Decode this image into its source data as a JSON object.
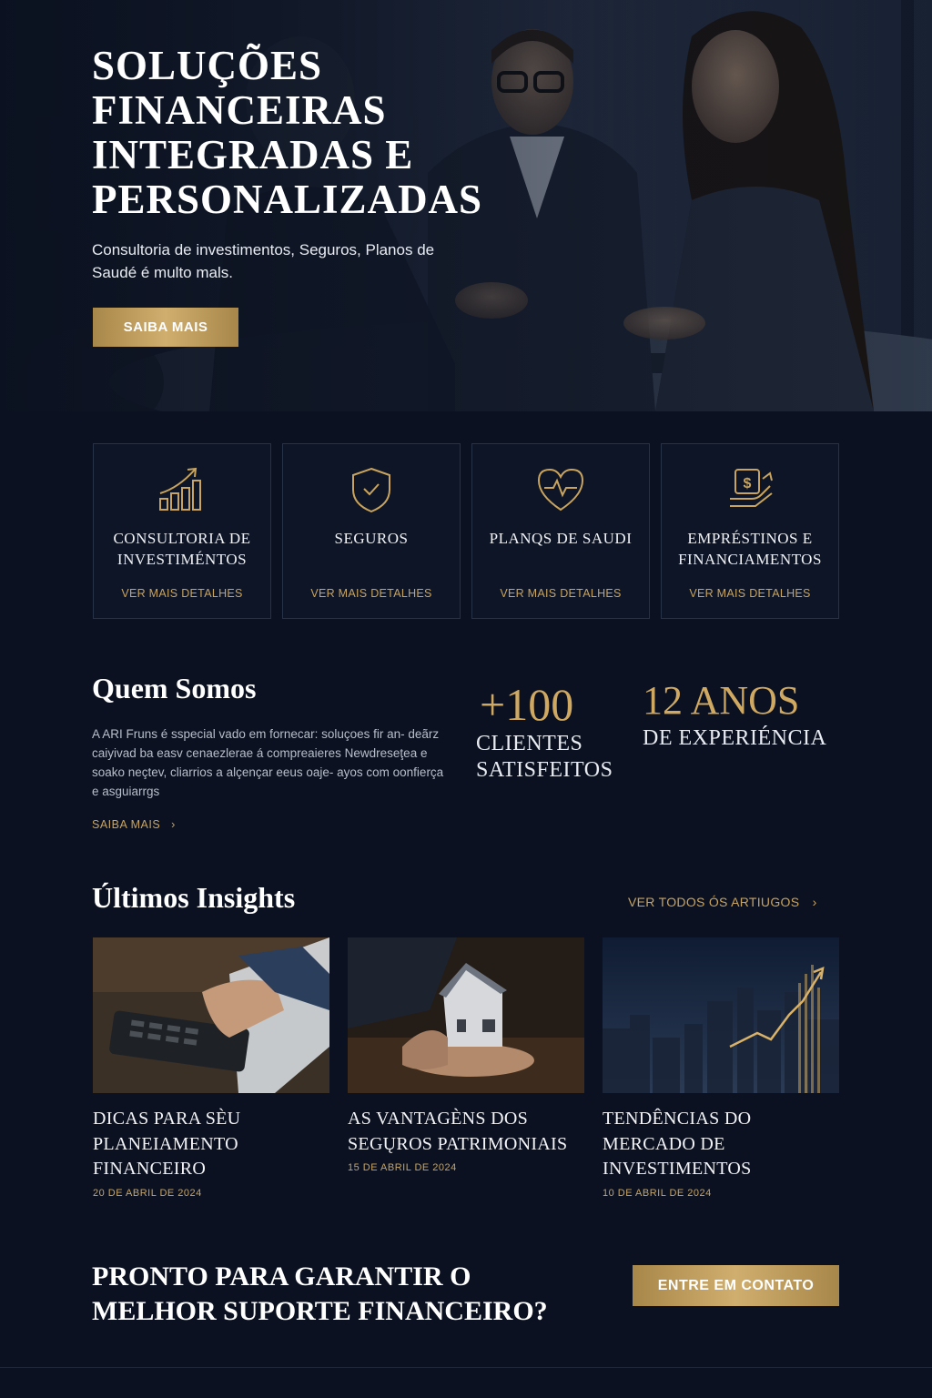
{
  "hero": {
    "title": "SOLUÇÕES FINANCEIRAS INTEGRADAS E PERSONALIZADAS",
    "subtitle": "Consultoria de investimentos, Seguros, Planos de Saudé é multo mals.",
    "button": "SAIBA MAIS"
  },
  "services": [
    {
      "title": "CONSULTORIA DE INVESTIMÉNTOS",
      "link": "VER MAIS DETALHES",
      "icon": "growth-chart-icon"
    },
    {
      "title": "SEGUROS",
      "link": "VER MAIS DETALHES",
      "icon": "shield-check-icon"
    },
    {
      "title": "PLANQS DE SAUDI",
      "link": "VER MAIS DETALHES",
      "icon": "heart-pulse-icon"
    },
    {
      "title": "EMPRÉSTINOS E FINANCIAMENTOS",
      "link": "VER MAIS DETALHES",
      "icon": "money-exchange-icon"
    }
  ],
  "about": {
    "title": "Quem Somos",
    "text": "A ARI Fruns é sspecial vado em fornecar: soluçoes fir an- deãrz caiyivad ba easv cenaezlerae á compreaieres Newdreseţea e soako neçtev, cliarrios a alçençar eeus oaje- ayos com oonfierça e asguiarrgs",
    "link": "SAIBA MAIS",
    "stats": [
      {
        "number": "+100",
        "label_1": "CLIENTES",
        "label_2": "SATISFEITOS"
      },
      {
        "number": "12 ANOS",
        "label_1": "DE EXPERIÉNCIA",
        "label_2": ""
      }
    ]
  },
  "insights": {
    "title": "Últimos Insights",
    "view_all": "VER TODOS ÓS ARTIUGOS",
    "articles": [
      {
        "title": "DICAS PARA SÈU PLANEIAMENTO FINANCEIRO",
        "date": "20 DE ABRIL DE 2024",
        "image": "calculator-photo"
      },
      {
        "title": "AS VANTAGÈNS DOS SEGŲROS PATRIMONIAIS",
        "date": "15 DE ABRIL DE 2024",
        "image": "house-in-hands-photo"
      },
      {
        "title": "TENDÊNCIAS DO MERCADO DE INVESTIMENTOS",
        "date": "10 DE ABRIL DE 2024",
        "image": "city-growth-photo"
      }
    ]
  },
  "cta": {
    "title": "PRONTO PARA GARANTIR O MELHOR SUPORTE FINANCEIRO?",
    "button": "ENTRE EM CONTATO"
  },
  "colors": {
    "background": "#0b1120",
    "gold": "#c9a45e",
    "card_border": "#263247"
  }
}
